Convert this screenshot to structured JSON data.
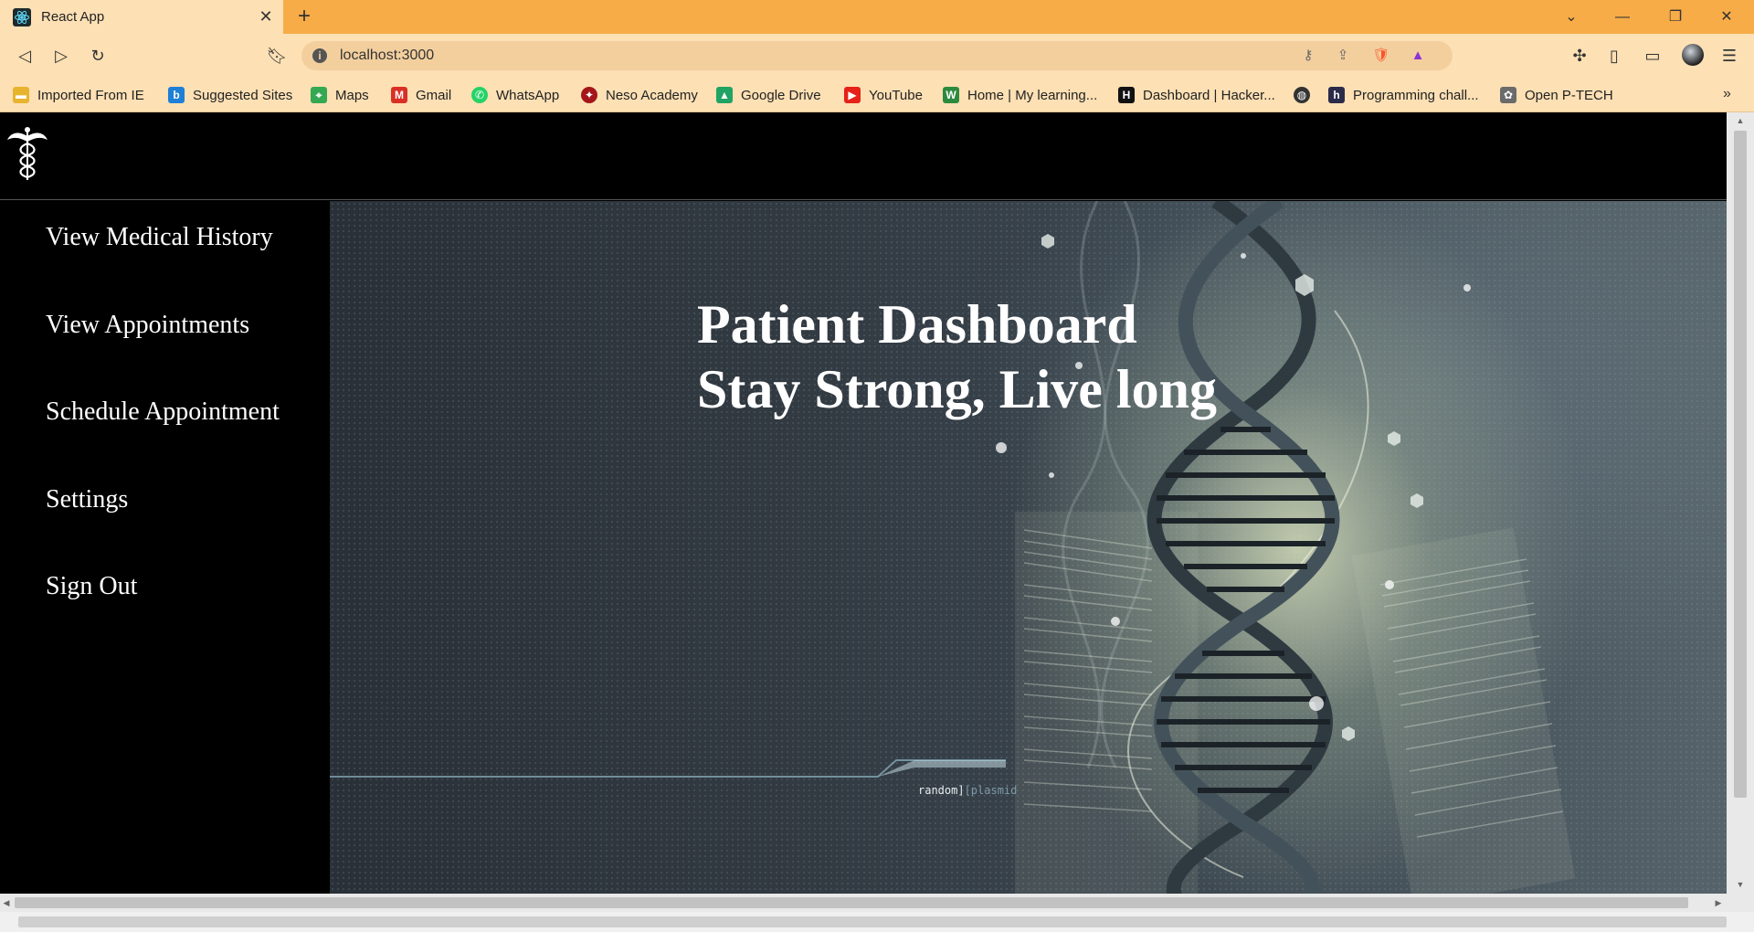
{
  "browser": {
    "tab_title": "React App",
    "url": "localhost:3000",
    "icons": {
      "back": "back-icon",
      "forward": "forward-icon",
      "reload": "reload-icon",
      "bookmark": "bookmark-icon",
      "close_tab": "close-icon",
      "new_tab": "plus-icon",
      "password": "key-icon",
      "share": "share-icon",
      "brave": "brave-shield-icon",
      "rewards": "rewards-icon",
      "extensions": "puzzle-icon",
      "sidebar": "sidebar-icon",
      "wallet": "wallet-icon",
      "profile": "profile-avatar",
      "menu": "menu-icon"
    },
    "bookmarks": [
      {
        "label": "Imported From IE",
        "icon": "folder-icon",
        "color": "#e8b32e"
      },
      {
        "label": "Suggested Sites",
        "icon": "bing-icon",
        "color": "#1e7fd6"
      },
      {
        "label": "Maps",
        "icon": "maps-icon",
        "color": "#34a853"
      },
      {
        "label": "Gmail",
        "icon": "gmail-icon",
        "color": "#d93025"
      },
      {
        "label": "WhatsApp",
        "icon": "whatsapp-icon",
        "color": "#25d366"
      },
      {
        "label": "Neso Academy",
        "icon": "neso-icon",
        "color": "#a4161a"
      },
      {
        "label": "Google Drive",
        "icon": "drive-icon",
        "color": "#1fa463"
      },
      {
        "label": "YouTube",
        "icon": "youtube-icon",
        "color": "#e62117"
      },
      {
        "label": "Home | My learning...",
        "icon": "w-icon",
        "color": "#2c8a3e"
      },
      {
        "label": "Dashboard | Hacker...",
        "icon": "hackerrank-icon",
        "color": "#111111"
      },
      {
        "label": "",
        "icon": "globe-icon",
        "color": "#333333"
      },
      {
        "label": "Programming chall...",
        "icon": "h-icon",
        "color": "#2b2b4a"
      },
      {
        "label": "Open P-TECH",
        "icon": "ptech-icon",
        "color": "#6b6b6b"
      }
    ]
  },
  "app": {
    "logo": "caduceus-logo",
    "sidebar": [
      {
        "label": "View Medical History"
      },
      {
        "label": "View Appointments"
      },
      {
        "label": "Schedule Appointment"
      },
      {
        "label": "Settings"
      },
      {
        "label": "Sign Out"
      }
    ],
    "hero": {
      "title_line1": "Patient Dashboard",
      "title_line2": "Stay Strong, Live long",
      "watermark_a": "random]",
      "watermark_b": "[plasmid",
      "image": "dna-helix-background"
    }
  },
  "colors": {
    "tab_bar": "#f7ac47",
    "toolbar": "#fde0b4",
    "page_bg": "#000000",
    "text": "#ffffff"
  }
}
